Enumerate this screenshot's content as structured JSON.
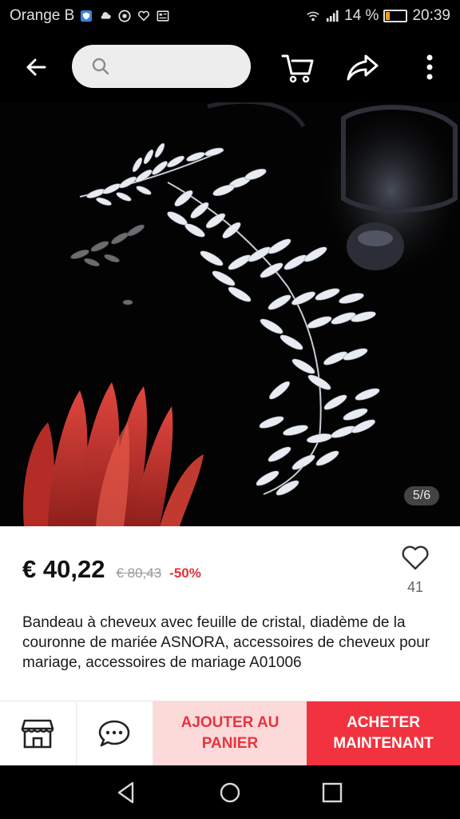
{
  "status_bar": {
    "carrier": "Orange B",
    "battery": "14 %",
    "time": "20:39"
  },
  "app_bar": {
    "search_placeholder": "",
    "icons": [
      "back-icon",
      "search-icon",
      "cart-icon",
      "share-icon",
      "more-icon"
    ]
  },
  "product_image": {
    "counter": "5/6"
  },
  "product": {
    "price": "€ 40,22",
    "old_price": "€ 80,43",
    "discount": "-50%",
    "wishlist_count": "41",
    "title": "Bandeau à cheveux avec feuille de cristal, diadème de la couronne de mariée ASNORA, accessoires de cheveux pour mariage, accessoires de mariage A01006"
  },
  "actions": {
    "add_to_cart_line1": "AJOUTER AU",
    "add_to_cart_line2": "PANIER",
    "buy_now_line1": "ACHETER",
    "buy_now_line2": "MAINTENANT",
    "icons": [
      "store-icon",
      "chat-icon"
    ]
  },
  "colors": {
    "accent": "#f2323f",
    "accent_light": "#fcdada",
    "discount": "#e62e3a",
    "battery": "#f29b1d"
  }
}
